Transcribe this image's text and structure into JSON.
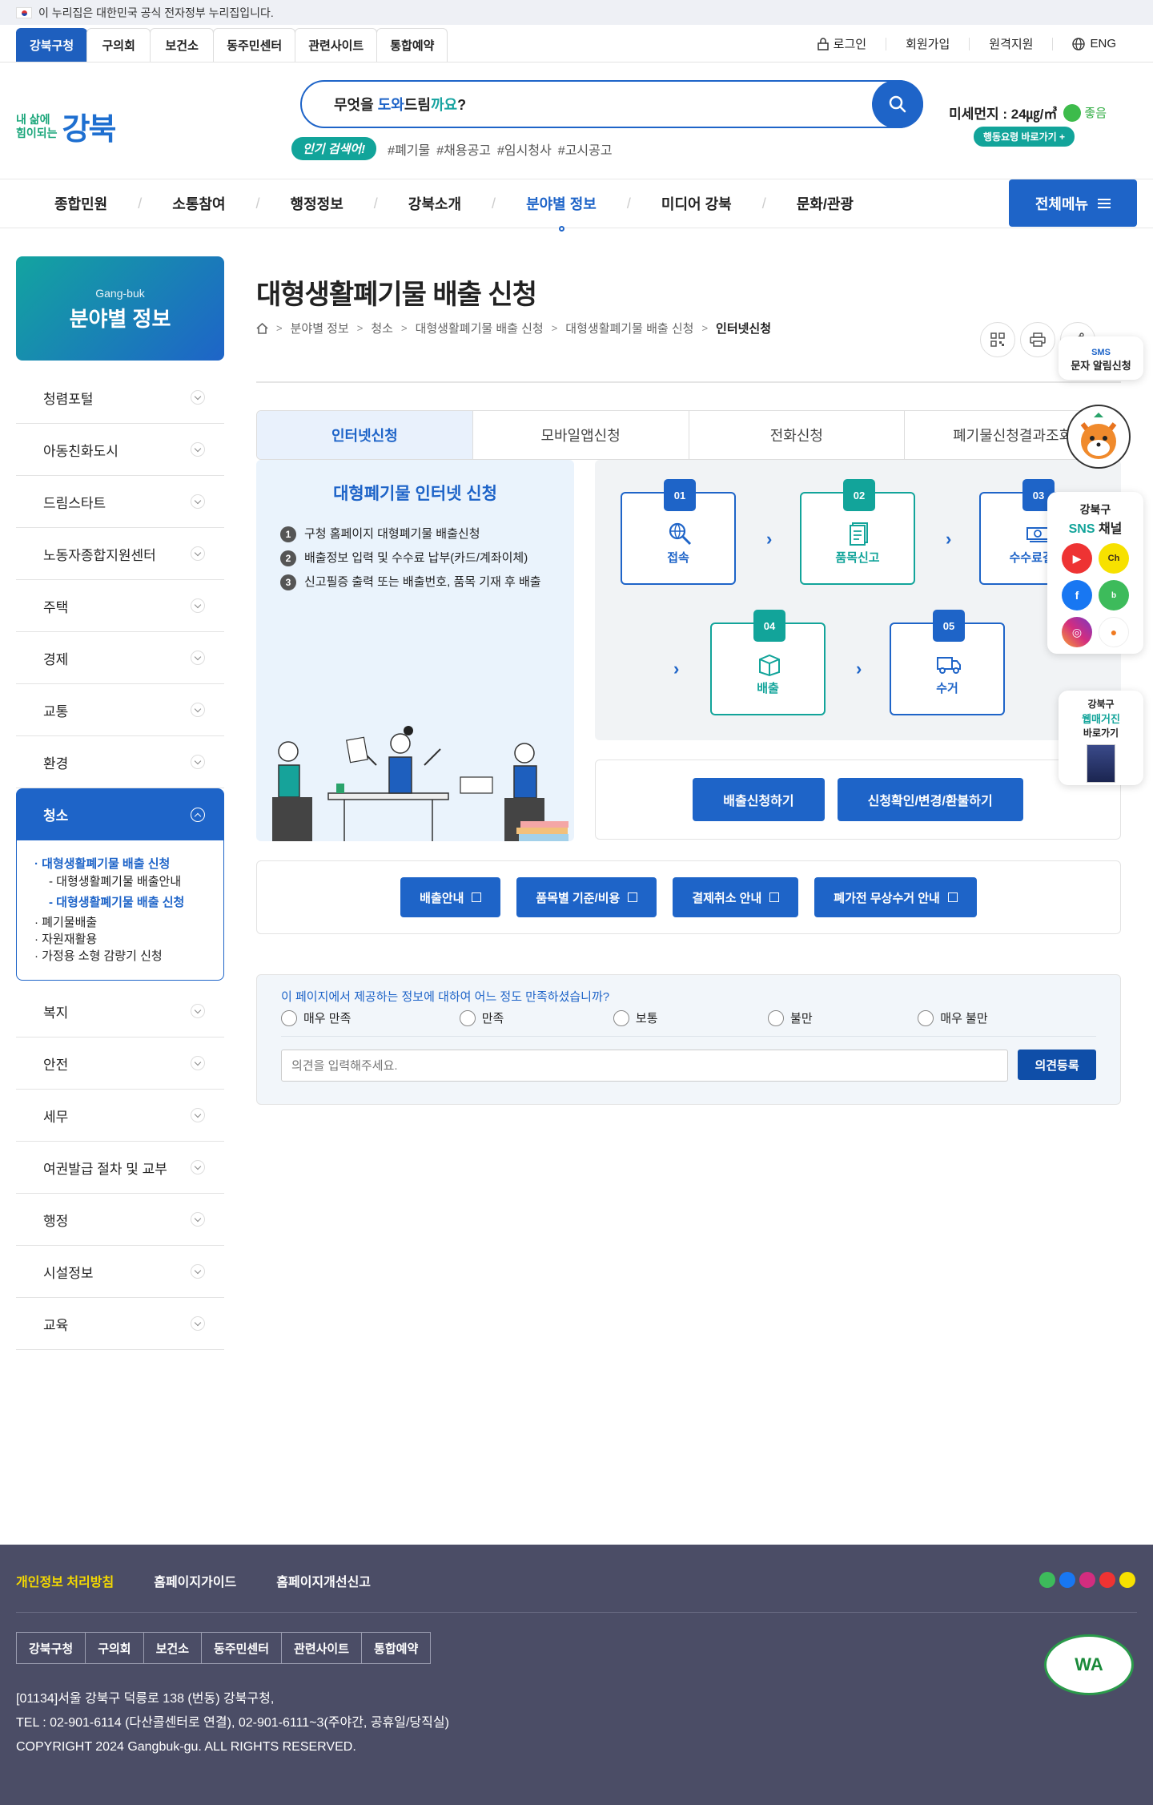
{
  "gov_banner": {
    "text": "이 누리집은 대한민국 공식 전자정부 누리집입니다."
  },
  "site_tabs": [
    "강북구청",
    "구의회",
    "보건소",
    "동주민센터",
    "관련사이트",
    "통합예약"
  ],
  "util": {
    "login": "로그인",
    "join": "회원가입",
    "remote": "원격지원",
    "lang": "ENG"
  },
  "logo": {
    "line1": "내 삶에",
    "line2": "힘이되는",
    "brand": "강북"
  },
  "search": {
    "pre": "무엇을 ",
    "hl1": "도와",
    "mid": "드림",
    "hl2": "까요",
    "post": "?"
  },
  "hot": {
    "label": "인기 검색어!",
    "tags": [
      "#폐기물",
      "#채용공고",
      "#임시청사",
      "#고시공고"
    ]
  },
  "dust": {
    "label": "미세먼지 : 24㎍/㎥",
    "status": "좋음",
    "link": "행동요령 바로가기 +"
  },
  "gnb": {
    "items": [
      "종합민원",
      "소통참여",
      "행정정보",
      "강북소개",
      "분야별 정보",
      "미디어 강북",
      "문화/관광"
    ],
    "all": "전체메뉴"
  },
  "side": {
    "en": "Gang-buk",
    "title": "분야별 정보",
    "items_top": [
      "청렴포털",
      "아동친화도시",
      "드림스타트",
      "노동자종합지원센터",
      "주택",
      "경제",
      "교통",
      "환경"
    ],
    "active": "청소",
    "sub": [
      "· 대형생활폐기물 배출 신청",
      "- 대형생활폐기물 배출안내",
      "- 대형생활폐기물 배출 신청",
      "· 폐기물배출",
      "· 자원재활용",
      "· 가정용 소형 감량기 신청"
    ],
    "items_bottom": [
      "복지",
      "안전",
      "세무",
      "여권발급 절차 및 교부",
      "행정",
      "시설정보",
      "교육"
    ]
  },
  "page": {
    "title": "대형생활폐기물 배출 신청",
    "crumbs": [
      "분야별 정보",
      "청소",
      "대형생활폐기물 배출 신청",
      "대형생활폐기물 배출 신청",
      "인터넷신청"
    ]
  },
  "tabs": [
    "인터넷신청",
    "모바일앱신청",
    "전화신청",
    "폐기물신청결과조회"
  ],
  "guide": {
    "title": "대형폐기물 인터넷 신청",
    "steps": [
      "구청 홈페이지 대형폐기물 배출신청",
      "배출정보 입력 및 수수료 납부(카드/계좌이체)",
      "신고필증 출력 또는 배출번호, 품목 기재 후 배출"
    ]
  },
  "process": [
    {
      "no": "01",
      "label": "접속"
    },
    {
      "no": "02",
      "label": "품목신고"
    },
    {
      "no": "03",
      "label": "수수료결제"
    },
    {
      "no": "04",
      "label": "배출"
    },
    {
      "no": "05",
      "label": "수거"
    }
  ],
  "buttons": {
    "apply": "배출신청하기",
    "confirm": "신청확인/변경/환불하기"
  },
  "links": [
    "배출안내",
    "품목별 기준/비용",
    "결제취소 안내",
    "폐가전 무상수거 안내"
  ],
  "survey": {
    "question": "이 페이지에서 제공하는 정보에 대하여 어느 정도 만족하셨습니까?",
    "options": [
      "매우 만족",
      "만족",
      "보통",
      "불만",
      "매우 불만"
    ],
    "placeholder": "의견을 입력해주세요.",
    "submit": "의견등록"
  },
  "quick": {
    "sms_small": "SMS",
    "sms": "문자 알림신청",
    "sns1": "강북구",
    "sns2a": "SNS",
    "sns2b": " 채널",
    "web1": "강북구",
    "web2": "웹매거진",
    "web3": "바로가기"
  },
  "footer": {
    "links": [
      "개인정보 처리방침",
      "홈페이지가이드",
      "홈페이지개선신고"
    ],
    "tabs": [
      "강북구청",
      "구의회",
      "보건소",
      "동주민센터",
      "관련사이트",
      "통합예약"
    ],
    "addr": "[01134]서울 강북구 덕릉로 138 (번동) 강북구청,",
    "tel": "TEL : 02-901-6114 (다산콜센터로 연결), 02-901-6111~3(주야간, 공휴일/당직실)",
    "copy": "COPYRIGHT 2024 Gangbuk-gu. ALL RIGHTS RESERVED.",
    "wa": "WA"
  }
}
